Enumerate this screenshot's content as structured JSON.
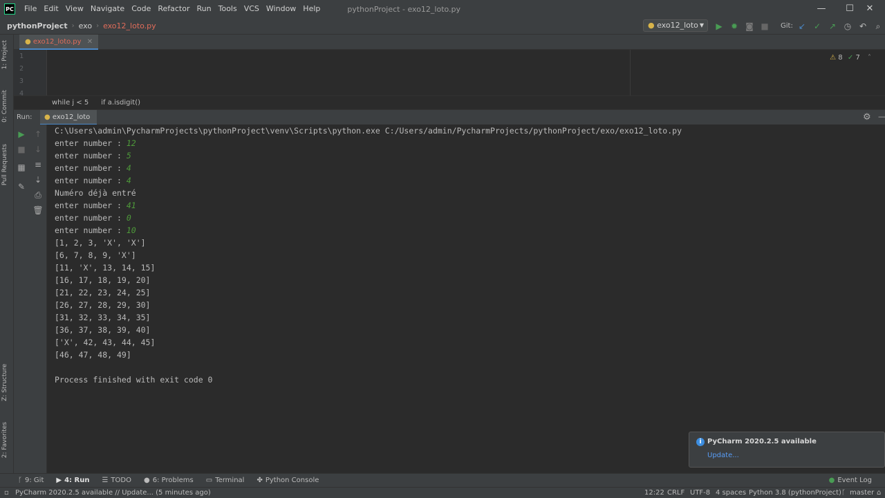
{
  "menubar": {
    "logo": "PC",
    "items": [
      "File",
      "Edit",
      "View",
      "Navigate",
      "Code",
      "Refactor",
      "Run",
      "Tools",
      "VCS",
      "Window",
      "Help"
    ],
    "window_title": "pythonProject - exo12_loto.py",
    "minimize": "—",
    "maximize": "☐",
    "close": "✕"
  },
  "navbar": {
    "project": "pythonProject",
    "folder": "exo",
    "file": "exo12_loto.py",
    "run_config": "exo12_loto",
    "git_label": "Git:"
  },
  "left_strip": {
    "project": "1: Project",
    "commit": "0: Commit",
    "pull_requests": "Pull Requests",
    "structure": "Z: Structure",
    "favorites": "2: Favorites"
  },
  "editor": {
    "tab": "exo12_loto.py",
    "line_numbers": [
      "1",
      "2",
      "3",
      "4"
    ],
    "inspections_warnings": "8",
    "inspections_ok": "7"
  },
  "code_breadcrumb": [
    "while j < 5",
    "if a.isdigit()"
  ],
  "run": {
    "label": "Run:",
    "tab": "exo12_loto"
  },
  "console": {
    "command": "C:\\Users\\admin\\PycharmProjects\\pythonProject\\venv\\Scripts\\python.exe C:/Users/admin/PycharmProjects/pythonProject/exo/exo12_loto.py",
    "prompts": [
      {
        "prompt": "enter number : ",
        "input": "12"
      },
      {
        "prompt": "enter number : ",
        "input": "5"
      },
      {
        "prompt": "enter number : ",
        "input": "4"
      },
      {
        "prompt": "enter number : ",
        "input": "4"
      }
    ],
    "already_entered": "Numéro déjà entré",
    "prompts2": [
      {
        "prompt": "enter number : ",
        "input": "41"
      },
      {
        "prompt": "enter number : ",
        "input": "0"
      },
      {
        "prompt": "enter number : ",
        "input": "10"
      }
    ],
    "grid_rows": [
      "[1, 2, 3, 'X', 'X']",
      "[6, 7, 8, 9, 'X']",
      "[11, 'X', 13, 14, 15]",
      "[16, 17, 18, 19, 20]",
      "[21, 22, 23, 24, 25]",
      "[26, 27, 28, 29, 30]",
      "[31, 32, 33, 34, 35]",
      "[36, 37, 38, 39, 40]",
      "['X', 42, 43, 44, 45]",
      "[46, 47, 48, 49]"
    ],
    "finished": "Process finished with exit code 0"
  },
  "notification": {
    "title": "PyCharm 2020.2.5 available",
    "link": "Update..."
  },
  "bottom_tabs": {
    "git": "9: Git",
    "run": "4: Run",
    "todo": "TODO",
    "problems": "6: Problems",
    "terminal": "Terminal",
    "python_console": "Python Console",
    "event_log": "Event Log"
  },
  "status_bar": {
    "message": "PyCharm 2020.2.5 available // Update... (5 minutes ago)",
    "position": "12:22",
    "line_sep": "CRLF",
    "encoding": "UTF-8",
    "indent": "4 spaces",
    "interpreter": "Python 3.8 (pythonProject)",
    "branch": "master"
  },
  "colors": {
    "accent_blue": "#4a88c7",
    "run_green": "#499c54",
    "input_green": "#4e9a3a",
    "file_red": "#e06c5a"
  }
}
